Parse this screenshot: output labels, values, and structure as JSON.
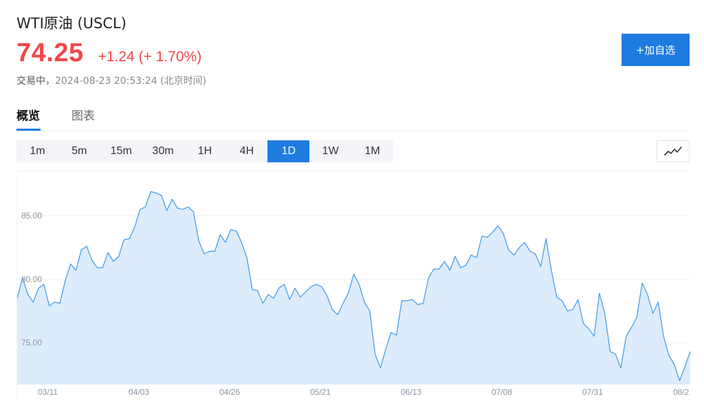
{
  "header": {
    "title": "WTI原油 (USCL)",
    "price": "74.25",
    "change": "+1.24 (+ 1.70%)",
    "status_label": "交易中，",
    "timestamp": "2024-08-23 20:53:24",
    "timezone": "(北京时间)",
    "add_watch_label": "+加自选"
  },
  "tabs": [
    {
      "label": "概览",
      "active": true
    },
    {
      "label": "图表",
      "active": false
    }
  ],
  "ranges": [
    "1m",
    "5m",
    "15m",
    "30m",
    "1H",
    "4H",
    "1D",
    "1W",
    "1M"
  ],
  "active_range": "1D",
  "colors": {
    "accent": "#1e7ce0",
    "up": "#f04848",
    "line": "#4a9eea",
    "area": "#dcecfc"
  },
  "chart_data": {
    "type": "area",
    "x_tick_labels": [
      "03/11",
      "04/03",
      "04/26",
      "05/21",
      "06/13",
      "07/08",
      "07/31",
      "08/2"
    ],
    "y_tick_labels": [
      "85.00",
      "80.00",
      "75.00"
    ],
    "y_ticks": [
      85,
      80,
      75
    ],
    "ylim": [
      71.7,
      88.5
    ],
    "grid": true,
    "values": [
      78.5,
      80.1,
      78.8,
      78.2,
      79.3,
      79.6,
      77.9,
      78.2,
      78.1,
      79.9,
      81.2,
      80.7,
      82.3,
      82.6,
      81.5,
      80.9,
      80.9,
      82.1,
      81.4,
      81.8,
      83.1,
      83.2,
      84.1,
      85.5,
      85.7,
      86.9,
      86.8,
      86.6,
      85.4,
      86.3,
      85.6,
      85.5,
      85.7,
      85.3,
      83.0,
      82.0,
      82.2,
      82.2,
      83.5,
      82.9,
      83.9,
      83.8,
      82.9,
      81.7,
      79.2,
      79.1,
      78.1,
      78.8,
      78.5,
      79.3,
      79.6,
      78.4,
      79.3,
      78.6,
      79.0,
      79.4,
      79.6,
      79.4,
      78.7,
      77.6,
      77.2,
      78.1,
      78.9,
      80.4,
      79.6,
      78.2,
      77.5,
      74.1,
      73.0,
      74.5,
      75.8,
      75.6,
      78.3,
      78.3,
      78.4,
      78.0,
      78.1,
      80.1,
      80.8,
      80.8,
      81.4,
      80.7,
      81.8,
      80.9,
      81.1,
      81.9,
      81.7,
      83.4,
      83.3,
      83.7,
      84.2,
      83.6,
      82.3,
      81.9,
      82.5,
      82.9,
      82.2,
      82.0,
      81.0,
      83.2,
      80.7,
      78.6,
      78.3,
      77.5,
      77.6,
      78.4,
      76.5,
      76.1,
      75.5,
      78.9,
      77.3,
      74.3,
      74.1,
      73.0,
      75.5,
      76.2,
      77.0,
      79.7,
      78.8,
      77.3,
      78.2,
      75.5,
      74.0,
      73.3,
      72.0,
      73.1,
      74.3
    ]
  }
}
